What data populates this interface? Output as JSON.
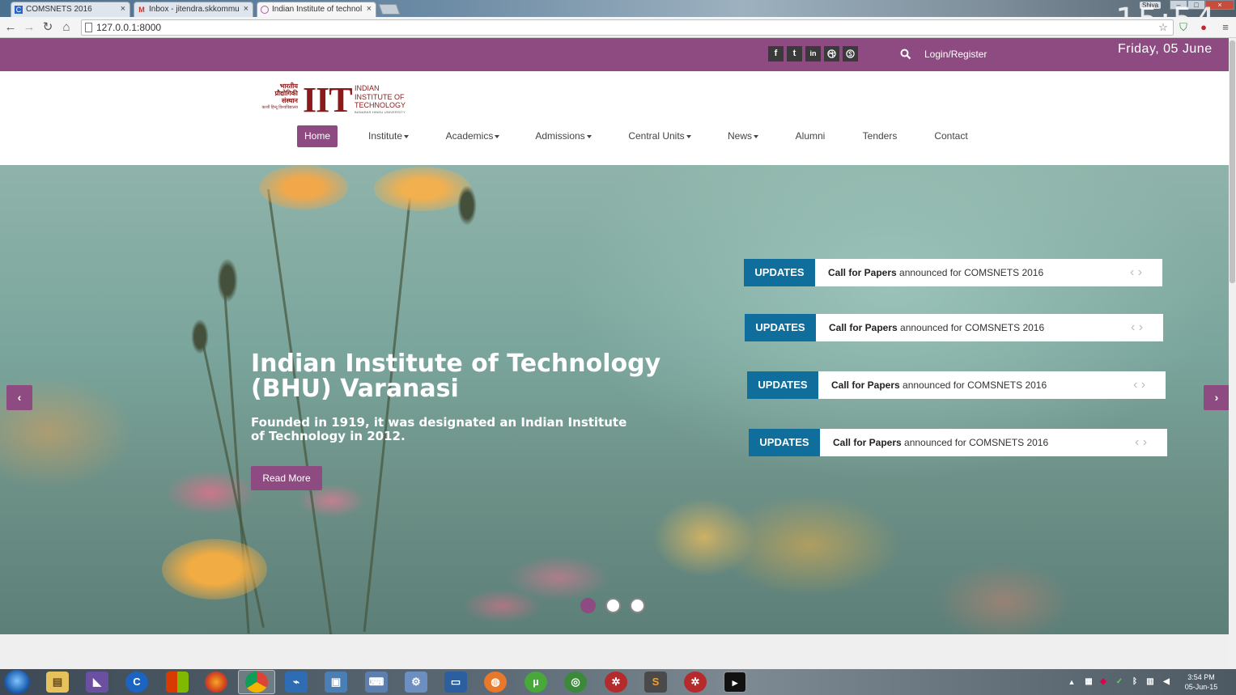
{
  "browser": {
    "tabs": [
      {
        "title": "COMSNETS 2016",
        "icon": "comsnets-favicon"
      },
      {
        "title": "Inbox - jitendra.skkommu",
        "icon": "gmail-favicon"
      },
      {
        "title": "Indian Institute of technol",
        "icon": "page-favicon"
      }
    ],
    "address": "127.0.0.1:8000",
    "overlay_time": "15:54",
    "overlay_date": "Friday, 05 June",
    "user_badge": "Shiva"
  },
  "site": {
    "social_icons": [
      "f",
      "t",
      "in",
      "dribbble",
      "skype"
    ],
    "login_label": "Login/Register",
    "logo": {
      "hindi_lines": [
        "भारतीय",
        "प्रौद्योगिकी",
        "संस्थान",
        "काशी हिन्दू विश्वविद्यालय"
      ],
      "acronym": "IIT",
      "english_lines": [
        "INDIAN",
        "INSTITUTE OF",
        "TECHNOLOGY"
      ],
      "subline": "BANARAS HINDU UNIVERSITY"
    },
    "nav": [
      {
        "label": "Home",
        "dropdown": false,
        "active": true
      },
      {
        "label": "Institute",
        "dropdown": true
      },
      {
        "label": "Academics",
        "dropdown": true
      },
      {
        "label": "Admissions",
        "dropdown": true
      },
      {
        "label": "Central Units",
        "dropdown": true
      },
      {
        "label": "News",
        "dropdown": true
      },
      {
        "label": "Alumni",
        "dropdown": false
      },
      {
        "label": "Tenders",
        "dropdown": false
      },
      {
        "label": "Contact",
        "dropdown": false
      }
    ],
    "accent": "#8e4b82",
    "updates_color": "#0f6e9b"
  },
  "hero": {
    "title": "Indian Institute of Technology (BHU) Varanasi",
    "subtitle": "Founded in 1919, it was designated an Indian Institute of Technology in 2012.",
    "button": "Read More",
    "prev": "‹",
    "next": "›",
    "slides_total": 3,
    "slide_active": 1
  },
  "updates": [
    {
      "label": "UPDATES",
      "bold": "Call for Papers",
      "text": " announced for COMSNETS 2016"
    },
    {
      "label": "UPDATES",
      "bold": "Call for Papers",
      "text": " announced for COMSNETS 2016"
    },
    {
      "label": "UPDATES",
      "bold": "Call for Papers",
      "text": " announced for COMSNETS 2016"
    },
    {
      "label": "UPDATES",
      "bold": "Call for Papers",
      "text": " announced for COMSNETS 2016"
    }
  ],
  "taskbar": {
    "time": "3:54 PM",
    "date": "05-Jun-15"
  }
}
